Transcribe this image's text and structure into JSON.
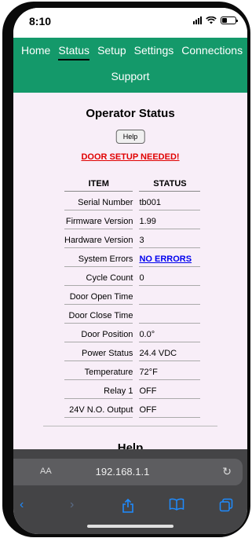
{
  "status_bar": {
    "time": "8:10"
  },
  "nav": {
    "items": [
      {
        "label": "Home"
      },
      {
        "label": "Status"
      },
      {
        "label": "Setup"
      },
      {
        "label": "Settings"
      },
      {
        "label": "Connections"
      }
    ],
    "support_label": "Support",
    "active": "Status"
  },
  "page": {
    "title": "Operator Status",
    "help_button": "Help",
    "warning": "DOOR SETUP NEEDED!",
    "table": {
      "headers": [
        "ITEM",
        "STATUS"
      ],
      "rows": [
        {
          "item": "Serial Number",
          "status": "tb001"
        },
        {
          "item": "Firmware Version",
          "status": "1.99"
        },
        {
          "item": "Hardware Version",
          "status": "3"
        },
        {
          "item": "System Errors",
          "status": "NO ERRORS"
        },
        {
          "item": "Cycle Count",
          "status": "0"
        },
        {
          "item": "Door Open Time",
          "status": ""
        },
        {
          "item": "Door Close Time",
          "status": ""
        },
        {
          "item": "Door Position",
          "status": "0.0°"
        },
        {
          "item": "Power Status",
          "status": "24.4 VDC"
        },
        {
          "item": "Temperature",
          "status": "72°F"
        },
        {
          "item": "Relay 1",
          "status": "OFF"
        },
        {
          "item": "24V N.O. Output",
          "status": "OFF"
        }
      ]
    },
    "help_heading": "Help"
  },
  "browser": {
    "aa_label": "AA",
    "url": "192.168.1.1",
    "icons": [
      "back-icon",
      "forward-icon",
      "share-icon",
      "bookmarks-icon",
      "tabs-icon",
      "reload-icon"
    ]
  },
  "colors": {
    "nav_bg": "#14996a",
    "content_bg": "#f8eef8",
    "warning": "#e00000",
    "link": "#0000ee",
    "browser_bg": "#444446",
    "toolbar_accent": "#1e8bff"
  }
}
